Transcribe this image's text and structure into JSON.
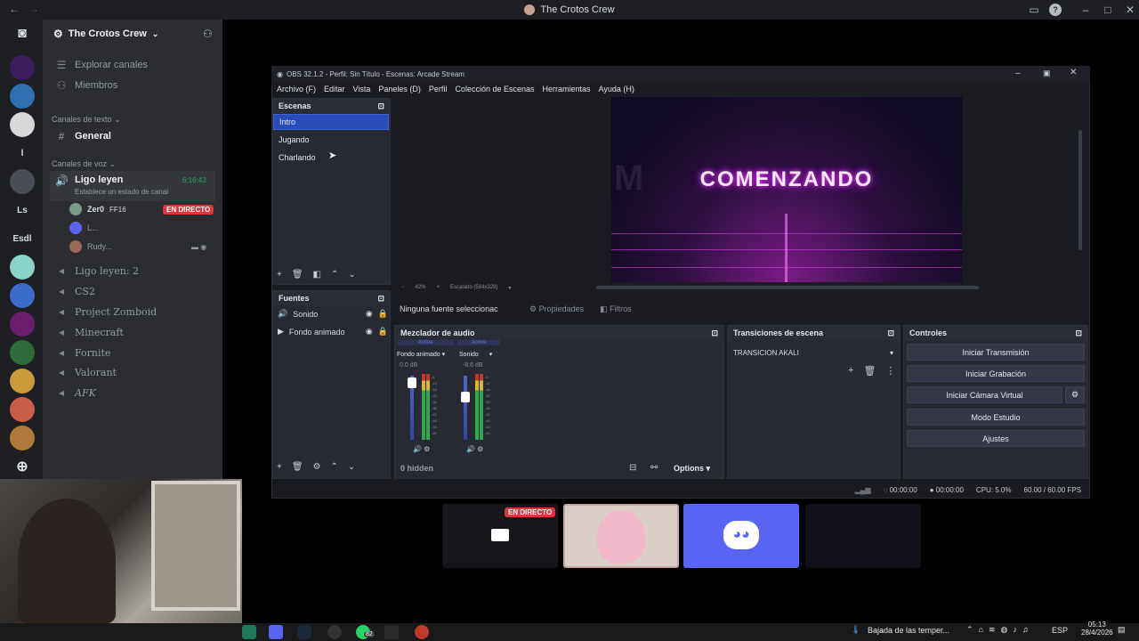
{
  "window": {
    "title": "The Crotos Crew"
  },
  "server": {
    "name": "The Crotos Crew"
  },
  "server_icons": [
    "l",
    "Ls",
    "Esdl"
  ],
  "nav": {
    "explore": "Explorar canales",
    "members": "Miembros"
  },
  "text_category": "Canales de texto",
  "text_channels": [
    "General"
  ],
  "voice_category": "Canales de voz",
  "voice_channel": {
    "name": "Ligo leyen",
    "timer": "6:16:43",
    "status": "Establece un estado de canal"
  },
  "voice_users": [
    {
      "name": "Zer0",
      "tag": "FF16",
      "live": "EN DIRECTO"
    },
    {
      "name": "L..."
    },
    {
      "name": "Rudy..."
    }
  ],
  "voice_channels": [
    "Ligo leyen: 2",
    "CS2",
    "Project Zomboid",
    "Minecraft",
    "Fornite",
    "Valorant",
    "AFK"
  ],
  "obs": {
    "title": "OBS 32.1.2 - Perfil: Sin Título - Escenas: Arcade Stream",
    "menu": [
      "Archivo (F)",
      "Editar",
      "Vista",
      "Paneles (D)",
      "Perfil",
      "Colección de Escenas",
      "Herramientas",
      "Ayuda (H)"
    ],
    "scenes_title": "Escenas",
    "scenes": [
      "Intro",
      "Jugando",
      "Charlando"
    ],
    "sources_title": "Fuentes",
    "sources": [
      "Sonido",
      "Fondo animado"
    ],
    "preview_text": "COMENZANDO",
    "preview_zoom": "42%",
    "preview_scale": "Escalado (584x329)",
    "no_source": "Ninguna fuente seleccionac",
    "properties": "Propiedades",
    "filters": "Filtros",
    "mixer_title": "Mezclador de audio",
    "mixer": [
      {
        "name": "Fondo animado",
        "db": "0.0 dB",
        "state": "Active"
      },
      {
        "name": "Sonido",
        "db": "-8.6 dB",
        "state": "Active"
      }
    ],
    "hidden": "0 hidden",
    "options": "Options",
    "transitions_title": "Transiciones de escena",
    "transition": "TRANSICION AKALI",
    "controls_title": "Controles",
    "controls": [
      "Iniciar Transmisión",
      "Iniciar Grabación",
      "Iniciar Cámara Virtual",
      "Modo Estudio",
      "Ajustes"
    ],
    "status": {
      "time1": "00:00:00",
      "time2": "00:00:00",
      "cpu": "CPU: 5.0%",
      "fps": "60.00 / 60.00 FPS"
    }
  },
  "stream_tile": {
    "live": "EN DIRECTO"
  },
  "taskbar": {
    "weather": "Bajada de las temper...",
    "lang": "ESP",
    "time": "05:13",
    "date": "28/4/2026",
    "badge": "82"
  }
}
